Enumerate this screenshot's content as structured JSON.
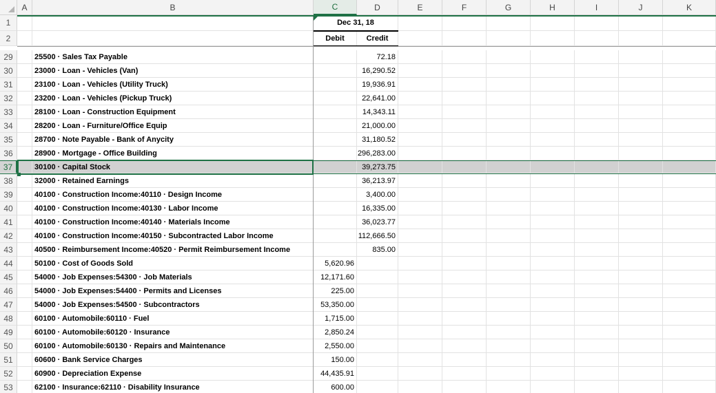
{
  "columns": [
    "A",
    "B",
    "C",
    "D",
    "E",
    "F",
    "G",
    "H",
    "I",
    "J",
    "K"
  ],
  "selected_column": "C",
  "selected_row": "37",
  "header_rows": [
    {
      "num": "1",
      "c": "",
      "d": "",
      "cd_merged": "Dec 31, 18"
    },
    {
      "num": "2",
      "c": "Debit",
      "d": "Credit"
    }
  ],
  "rows": [
    {
      "num": "29",
      "account": "25500 · Sales Tax Payable",
      "debit": "",
      "credit": "72.18"
    },
    {
      "num": "30",
      "account": "23000 · Loan - Vehicles (Van)",
      "debit": "",
      "credit": "16,290.52"
    },
    {
      "num": "31",
      "account": "23100 · Loan - Vehicles (Utility Truck)",
      "debit": "",
      "credit": "19,936.91"
    },
    {
      "num": "32",
      "account": "23200 · Loan - Vehicles (Pickup Truck)",
      "debit": "",
      "credit": "22,641.00"
    },
    {
      "num": "33",
      "account": "28100 · Loan - Construction Equipment",
      "debit": "",
      "credit": "14,343.11"
    },
    {
      "num": "34",
      "account": "28200 · Loan - Furniture/Office Equip",
      "debit": "",
      "credit": "21,000.00"
    },
    {
      "num": "35",
      "account": "28700 · Note Payable - Bank of Anycity",
      "debit": "",
      "credit": "31,180.52"
    },
    {
      "num": "36",
      "account": "28900 · Mortgage - Office Building",
      "debit": "",
      "credit": "296,283.00"
    },
    {
      "num": "37",
      "account": "30100 · Capital Stock",
      "debit": "",
      "credit": "39,273.75"
    },
    {
      "num": "38",
      "account": "32000 · Retained Earnings",
      "debit": "",
      "credit": "36,213.97"
    },
    {
      "num": "39",
      "account": "40100 · Construction Income:40110 · Design Income",
      "debit": "",
      "credit": "3,400.00"
    },
    {
      "num": "40",
      "account": "40100 · Construction Income:40130 · Labor Income",
      "debit": "",
      "credit": "16,335.00"
    },
    {
      "num": "41",
      "account": "40100 · Construction Income:40140 · Materials Income",
      "debit": "",
      "credit": "36,023.77"
    },
    {
      "num": "42",
      "account": "40100 · Construction Income:40150 · Subcontracted Labor Income",
      "debit": "",
      "credit": "112,666.50"
    },
    {
      "num": "43",
      "account": "40500 · Reimbursement Income:40520 · Permit Reimbursement Income",
      "debit": "",
      "credit": "835.00"
    },
    {
      "num": "44",
      "account": "50100 · Cost of Goods Sold",
      "debit": "5,620.96",
      "credit": ""
    },
    {
      "num": "45",
      "account": "54000 · Job Expenses:54300 · Job Materials",
      "debit": "12,171.60",
      "credit": ""
    },
    {
      "num": "46",
      "account": "54000 · Job Expenses:54400 · Permits and Licenses",
      "debit": "225.00",
      "credit": ""
    },
    {
      "num": "47",
      "account": "54000 · Job Expenses:54500 · Subcontractors",
      "debit": "53,350.00",
      "credit": ""
    },
    {
      "num": "48",
      "account": "60100 · Automobile:60110 · Fuel",
      "debit": "1,715.00",
      "credit": ""
    },
    {
      "num": "49",
      "account": "60100 · Automobile:60120 · Insurance",
      "debit": "2,850.24",
      "credit": ""
    },
    {
      "num": "50",
      "account": "60100 · Automobile:60130 · Repairs and Maintenance",
      "debit": "2,550.00",
      "credit": ""
    },
    {
      "num": "51",
      "account": "60600 · Bank Service Charges",
      "debit": "150.00",
      "credit": ""
    },
    {
      "num": "52",
      "account": "60900 · Depreciation Expense",
      "debit": "44,435.91",
      "credit": ""
    },
    {
      "num": "53",
      "account": "62100 · Insurance:62110 · Disability Insurance",
      "debit": "600.00",
      "credit": ""
    }
  ],
  "colors": {
    "accent": "#1e7145",
    "selected_row_fill": "#d1d1d1"
  }
}
